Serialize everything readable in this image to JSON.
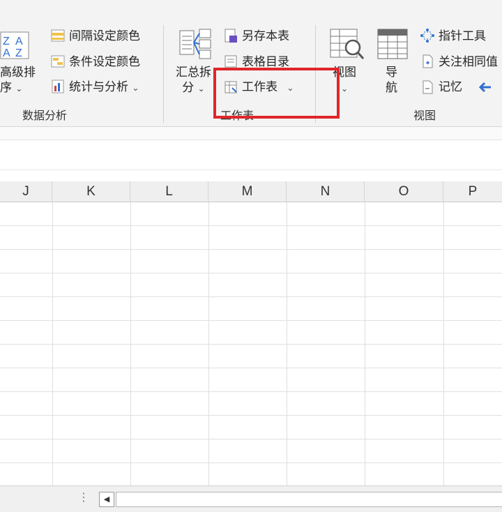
{
  "ribbon": {
    "data_analysis": {
      "sort_button_line1": "高级排",
      "sort_button_line2": "序",
      "interval_color": "间隔设定颜色",
      "condition_color": "条件设定颜色",
      "stats_analysis": "统计与分析",
      "group_label": "数据分析"
    },
    "worksheet": {
      "summarize_line1": "汇总拆",
      "summarize_line2": "分",
      "save_as_sheet": "另存本表",
      "sheet_toc": "表格目录",
      "worksheet_menu": "工作表",
      "group_label": "工作表"
    },
    "view": {
      "view_button_line1": "视图",
      "navigate_line1": "导",
      "navigate_line2": "航",
      "pointer_tool": "指针工具",
      "watch_same": "关注相同值",
      "memory": "记忆",
      "group_label": "视图"
    }
  },
  "grid": {
    "columns": [
      "J",
      "K",
      "L",
      "M",
      "N",
      "O",
      "P"
    ]
  },
  "colors": {
    "highlight": "#e0262a",
    "ribbon_bg": "#f3f3f3",
    "accent_blue": "#2f6fd0"
  }
}
